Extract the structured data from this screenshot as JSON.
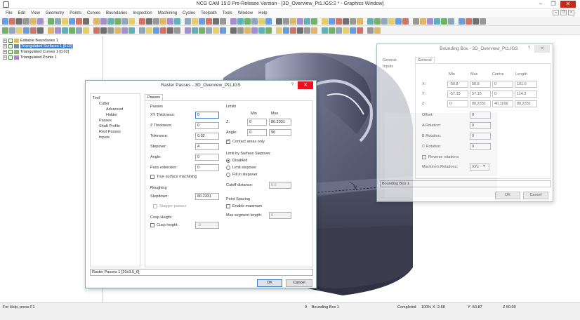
{
  "window": {
    "title": "NCG CAM 15.0 Pre-Release Version - [3D_Overview_Pt1.IGS:2 * - Graphics Window]",
    "min": "–",
    "max": "❐",
    "close": "✕"
  },
  "menu": [
    "File",
    "Edit",
    "View",
    "Geometry",
    "Points",
    "Curves",
    "Boundaries",
    "Inspection",
    "Machining",
    "Cycles",
    "Toolpath",
    "Tools",
    "Window",
    "Help"
  ],
  "tree": [
    {
      "label": "Editable Boundaries 1",
      "selected": false
    },
    {
      "label": "Triangulated Surfaces 1 [0.02]",
      "selected": true
    },
    {
      "label": "Triangulated Curves 1 [0.02]",
      "selected": false
    },
    {
      "label": "Triangulated Points 1",
      "selected": false
    }
  ],
  "raster": {
    "title": "Raster Passes - 3D_Overview_Pt1.IGS",
    "help": "?",
    "close": "✕",
    "nav": {
      "tool": "Tool",
      "cutter": "Cutter",
      "advanced": "Advanced",
      "holder": "Holder",
      "passes": "Passes",
      "shaft_profile": "Shaft Profile",
      "rest_passes": "Rest Passes",
      "inputs": "Inputs"
    },
    "tab": "Passes",
    "passes_group": "Passes",
    "xy_label": "XY Thickness:",
    "xy_value": "0",
    "z_label": "Z Thickness:",
    "z_value": "0",
    "tol_label": "Tolerance:",
    "tol_value": "0.02",
    "stepover_label": "Stepover:",
    "stepover_value": "4",
    "angle_label": "Angle:",
    "angle_value": "0",
    "passext_label": "Pass extension:",
    "passext_value": "0",
    "true_surface": "True surface machining",
    "roughing_group": "Roughing",
    "stepdown_label": "Stepdown:",
    "stepdown_value": "80.2331",
    "stagger": "Stagger passes",
    "cusp_group": "Cusp Height",
    "cusp_label": "Cusp height:",
    "cusp_value": "-3",
    "limits_group": "Limits",
    "min_hdr": "Min",
    "max_hdr": "Max",
    "z_lim_label": "Z:",
    "z_min": "0",
    "z_max": "80.2331",
    "angle_lim_label": "Angle:",
    "angle_min": "0",
    "angle_max": "90",
    "contact_only": "Contact areas only",
    "limit_group": "Limit by Surface Stepover",
    "disabled": "Disabled",
    "limit_stepover": "Limit stepover",
    "fill_stepover": "Fill in stepover",
    "cutoff_label": "Cutoff distance:",
    "cutoff_value": "0.6",
    "point_group": "Point Spacing",
    "enable_max": "Enable maximum",
    "max_seg_label": "Max segment length:",
    "max_seg_value": "0",
    "footer": "Raster Passes 1 [20x3.5_0]",
    "ok": "OK",
    "cancel": "Cancel"
  },
  "bbox": {
    "title": "Bounding Box - 3D_Overview_Pt1.IGS",
    "help": "?",
    "close": "✕",
    "nav": [
      "General",
      "Inputs"
    ],
    "tab": "General",
    "headers": {
      "min": "Min",
      "max": "Max",
      "centre": "Centre",
      "length": "Length"
    },
    "rows": [
      {
        "label": "X:",
        "min": "-50.8",
        "max": "50.8",
        "centre": "0",
        "length": "101.6"
      },
      {
        "label": "Y:",
        "min": "-57.15",
        "max": "57.15",
        "centre": "0",
        "length": "114.3"
      },
      {
        "label": "Z:",
        "min": "0",
        "max": "80.2331",
        "centre": "40.1166",
        "length": "80.2331"
      }
    ],
    "offset_label": "Offset:",
    "offset_value": "0",
    "arot_label": "A Rotation:",
    "arot_value": "0",
    "brot_label": "B Rotation:",
    "brot_value": "0",
    "crot_label": "C Rotation:",
    "crot_value": "0",
    "reverse": "Reverse rotations",
    "machine_label": "Machine's Rotations:",
    "machine_value": "XYz",
    "footer": "Bounding Box 1",
    "ok": "OK",
    "cancel": "Cancel"
  },
  "status": {
    "help": "For Help, press F1",
    "item_count": "0",
    "item": "Bounding Box 1",
    "completed": "Completed",
    "percent": "100%",
    "x": "X -2.58",
    "y": "Y -50.87",
    "z": "Z 50.00"
  },
  "colors": {
    "accent": "#3b7fd6",
    "close_red": "#e81123",
    "model": "#555a6e"
  }
}
